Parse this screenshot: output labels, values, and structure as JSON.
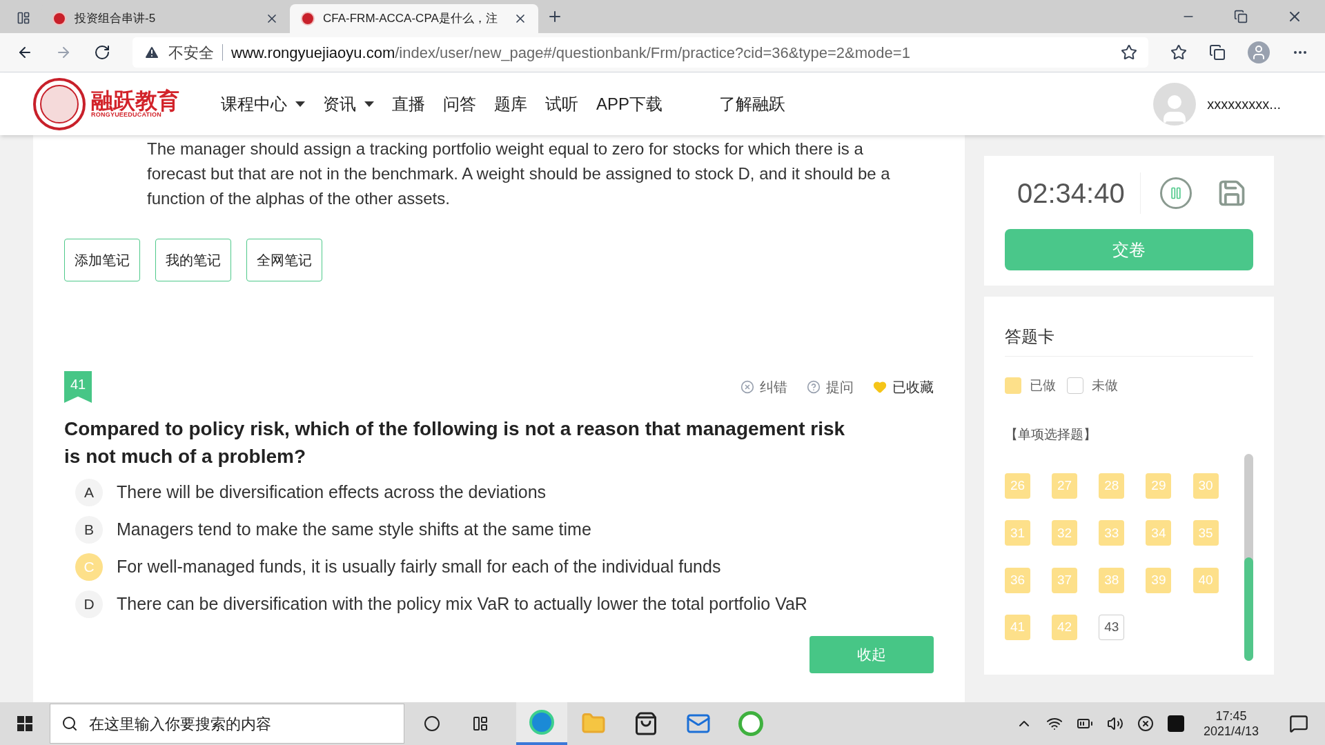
{
  "browser": {
    "tabs": [
      {
        "title": "投资组合串讲-5",
        "selected": false
      },
      {
        "title": "CFA-FRM-ACCA-CPA是什么，注",
        "selected": true
      }
    ],
    "address": {
      "warning": "不安全",
      "url_host": "www.rongyuejiaoyu.com",
      "url_path": "/index/user/new_page#/questionbank/Frm/practice?cid=36&type=2&mode=1"
    }
  },
  "site": {
    "logo_text": "融跃教育",
    "logo_subtext": "RONGYUEEDUCATION",
    "nav": [
      {
        "label": "课程中心",
        "dropdown": true
      },
      {
        "label": "资讯",
        "dropdown": true
      },
      {
        "label": "直播",
        "dropdown": false
      },
      {
        "label": "问答",
        "dropdown": false
      },
      {
        "label": "题库",
        "dropdown": false
      },
      {
        "label": "试听",
        "dropdown": false
      },
      {
        "label": "APP下载",
        "dropdown": false
      },
      {
        "label": "了解融跃",
        "dropdown": false
      }
    ],
    "user_name": "xxxxxxxxx..."
  },
  "explanation": "The manager should assign a tracking portfolio weight equal to zero for stocks for which there is a forecast but that are not in the benchmark. A weight should be assigned to stock D, and it should be a function of the alphas of the other assets.",
  "note_buttons": [
    "添加笔记",
    "我的笔记",
    "全网笔记"
  ],
  "question": {
    "number": "41",
    "actions": [
      {
        "kind": "report",
        "label": "纠错",
        "active": false
      },
      {
        "kind": "ask",
        "label": "提问",
        "active": false
      },
      {
        "kind": "favorite",
        "label": "已收藏",
        "active": true
      }
    ],
    "title": "Compared to policy risk, which of the following is not a reason that management risk is not much of a problem?",
    "options": [
      {
        "letter": "A",
        "text": "There will be diversification effects across the deviations",
        "selected": false
      },
      {
        "letter": "B",
        "text": "Managers tend to make the same style shifts at the same time",
        "selected": false
      },
      {
        "letter": "C",
        "text": "For well-managed funds, it is usually fairly small for each of the individual funds",
        "selected": true
      },
      {
        "letter": "D",
        "text": "There can be diversification with the policy mix VaR to actually lower the total portfolio VaR",
        "selected": false
      }
    ],
    "collapse_button": "收起"
  },
  "timer": {
    "time": "02:34:40",
    "submit_button": "交卷"
  },
  "answer_card": {
    "title": "答题卡",
    "legend": [
      {
        "label": "已做",
        "done": true
      },
      {
        "label": "未做",
        "done": false
      }
    ],
    "section": "【单项选择题】",
    "numbers": [
      {
        "label": "26",
        "done": true
      },
      {
        "label": "27",
        "done": true
      },
      {
        "label": "28",
        "done": true
      },
      {
        "label": "29",
        "done": true
      },
      {
        "label": "30",
        "done": true
      },
      {
        "label": "31",
        "done": true
      },
      {
        "label": "32",
        "done": true
      },
      {
        "label": "33",
        "done": true
      },
      {
        "label": "34",
        "done": true
      },
      {
        "label": "35",
        "done": true
      },
      {
        "label": "36",
        "done": true
      },
      {
        "label": "37",
        "done": true
      },
      {
        "label": "38",
        "done": true
      },
      {
        "label": "39",
        "done": true
      },
      {
        "label": "40",
        "done": true
      },
      {
        "label": "41",
        "done": true
      },
      {
        "label": "42",
        "done": true
      },
      {
        "label": "43",
        "done": false
      }
    ]
  },
  "taskbar": {
    "search_placeholder": "在这里输入你要搜索的内容",
    "time": "17:45",
    "date": "2021/4/13"
  }
}
